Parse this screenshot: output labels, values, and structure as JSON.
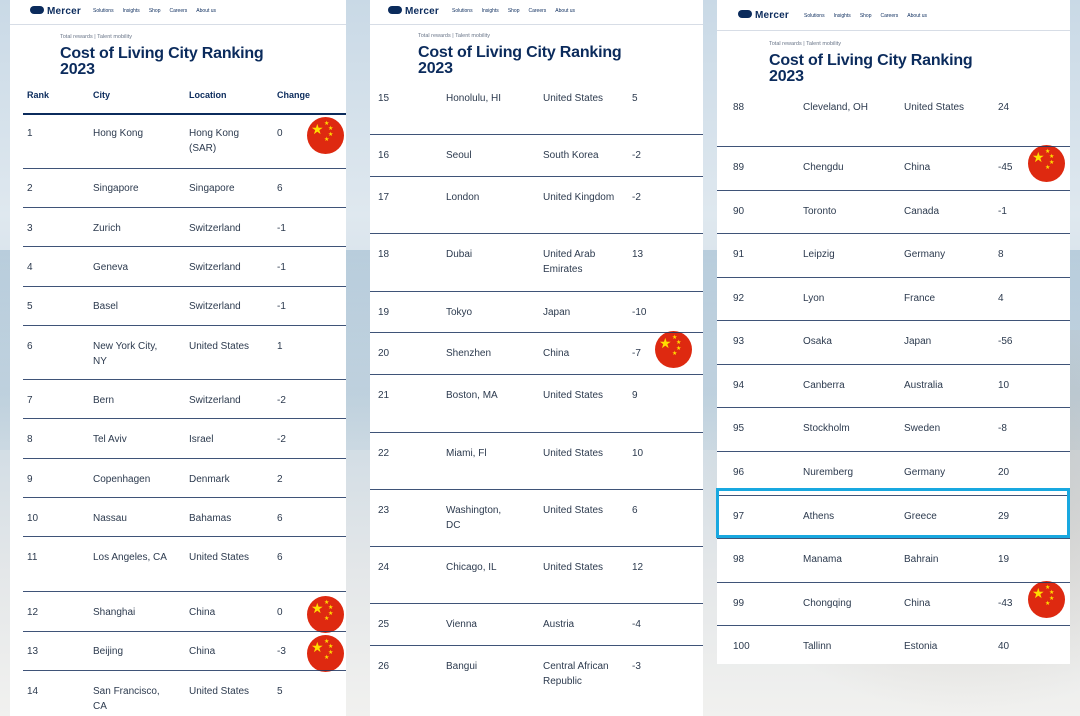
{
  "site": {
    "logo": "Mercer",
    "nav": [
      "Solutions",
      "Insights",
      "Shop",
      "Careers",
      "About us"
    ]
  },
  "breadcrumb": {
    "first": "Total rewards",
    "divider": "|",
    "second": "Talent mobility"
  },
  "title": {
    "line1": "Cost of Living City Ranking",
    "line2": "2023"
  },
  "columns": {
    "rank": "Rank",
    "city": "City",
    "location": "Location",
    "change": "Change"
  },
  "colors": {
    "brand_navy": "#0b2b5c",
    "flag_red": "#de2910",
    "flag_star": "#ffde00",
    "highlight": "#18a8e0"
  },
  "panel1": {
    "rows": [
      {
        "rank": "1",
        "city": "Hong Kong",
        "location": "Hong Kong (SAR)",
        "change": "0",
        "flag": true
      },
      {
        "rank": "2",
        "city": "Singapore",
        "location": "Singapore",
        "change": "6"
      },
      {
        "rank": "3",
        "city": "Zurich",
        "location": "Switzerland",
        "change": "-1"
      },
      {
        "rank": "4",
        "city": "Geneva",
        "location": "Switzerland",
        "change": "-1"
      },
      {
        "rank": "5",
        "city": "Basel",
        "location": "Switzerland",
        "change": "-1"
      },
      {
        "rank": "6",
        "city": "New York City, NY",
        "location": "United States",
        "change": "1"
      },
      {
        "rank": "7",
        "city": "Bern",
        "location": "Switzerland",
        "change": "-2"
      },
      {
        "rank": "8",
        "city": "Tel Aviv",
        "location": "Israel",
        "change": "-2"
      },
      {
        "rank": "9",
        "city": "Copenhagen",
        "location": "Denmark",
        "change": "2"
      },
      {
        "rank": "10",
        "city": "Nassau",
        "location": "Bahamas",
        "change": "6"
      },
      {
        "rank": "11",
        "city": "Los Angeles, CA",
        "location": "United States",
        "change": "6"
      },
      {
        "rank": "12",
        "city": "Shanghai",
        "location": "China",
        "change": "0",
        "flag": true
      },
      {
        "rank": "13",
        "city": "Beijing",
        "location": "China",
        "change": "-3",
        "flag": true
      },
      {
        "rank": "14",
        "city": "San Francisco, CA",
        "location": "United States",
        "change": "5"
      }
    ]
  },
  "panel2": {
    "rows": [
      {
        "rank": "15",
        "city": "Honolulu, HI",
        "location": "United States",
        "change": "5"
      },
      {
        "rank": "16",
        "city": "Seoul",
        "location": "South Korea",
        "change": "-2"
      },
      {
        "rank": "17",
        "city": "London",
        "location": "United Kingdom",
        "change": "-2"
      },
      {
        "rank": "18",
        "city": "Dubai",
        "location": "United Arab Emirates",
        "change": "13"
      },
      {
        "rank": "19",
        "city": "Tokyo",
        "location": "Japan",
        "change": "-10"
      },
      {
        "rank": "20",
        "city": "Shenzhen",
        "location": "China",
        "change": "-7",
        "flag": true
      },
      {
        "rank": "21",
        "city": "Boston, MA",
        "location": "United States",
        "change": "9"
      },
      {
        "rank": "22",
        "city": "Miami, Fl",
        "location": "United States",
        "change": "10"
      },
      {
        "rank": "23",
        "city": "Washington, DC",
        "location": "United States",
        "change": "6"
      },
      {
        "rank": "24",
        "city": "Chicago, IL",
        "location": "United States",
        "change": "12"
      },
      {
        "rank": "25",
        "city": "Vienna",
        "location": "Austria",
        "change": "-4"
      },
      {
        "rank": "26",
        "city": "Bangui",
        "location": "Central African Republic",
        "change": "-3"
      }
    ]
  },
  "panel3": {
    "rows": [
      {
        "rank": "88",
        "city": "Cleveland, OH",
        "location": "United States",
        "change": "24"
      },
      {
        "rank": "89",
        "city": "Chengdu",
        "location": "China",
        "change": "-45",
        "flag": true
      },
      {
        "rank": "90",
        "city": "Toronto",
        "location": "Canada",
        "change": "-1"
      },
      {
        "rank": "91",
        "city": "Leipzig",
        "location": "Germany",
        "change": "8"
      },
      {
        "rank": "92",
        "city": "Lyon",
        "location": "France",
        "change": "4"
      },
      {
        "rank": "93",
        "city": "Osaka",
        "location": "Japan",
        "change": "-56"
      },
      {
        "rank": "94",
        "city": "Canberra",
        "location": "Australia",
        "change": "10"
      },
      {
        "rank": "95",
        "city": "Stockholm",
        "location": "Sweden",
        "change": "-8"
      },
      {
        "rank": "96",
        "city": "Nuremberg",
        "location": "Germany",
        "change": "20"
      },
      {
        "rank": "97",
        "city": "Athens",
        "location": "Greece",
        "change": "29",
        "highlight": true
      },
      {
        "rank": "98",
        "city": "Manama",
        "location": "Bahrain",
        "change": "19"
      },
      {
        "rank": "99",
        "city": "Chongqing",
        "location": "China",
        "change": "-43",
        "flag": true
      },
      {
        "rank": "100",
        "city": "Tallinn",
        "location": "Estonia",
        "change": "40"
      }
    ]
  }
}
